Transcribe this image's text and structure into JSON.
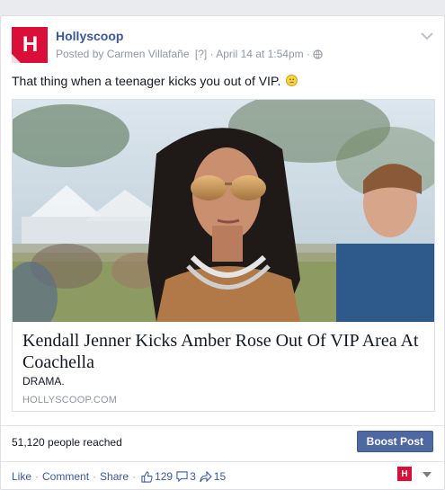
{
  "post": {
    "page_name": "Hollyscoop",
    "avatar_letter": "H",
    "posted_by": "Posted by Carmen Villafañe",
    "help_marker": "[?]",
    "date": "April 14 at 1:54pm",
    "separator": "·",
    "status_text": "That thing when a teenager kicks you out of VIP."
  },
  "link": {
    "title": "Kendall Jenner Kicks Amber Rose Out Of VIP Area At Coachella",
    "description": "DRAMA.",
    "domain": "HOLLYSCOOP.COM"
  },
  "footer": {
    "reach": "51,120 people reached",
    "boost_label": "Boost Post"
  },
  "actions": {
    "like": "Like",
    "comment": "Comment",
    "share": "Share",
    "likes_count": "129",
    "comments_count": "3",
    "shares_count": "15"
  },
  "colors": {
    "brand": "#d90f3a",
    "link_blue": "#3b5998",
    "boost_bg": "#4e69a2"
  },
  "icons": [
    "hollyscoop-logo",
    "chevron-down-icon",
    "globe-icon",
    "sad-emoji-icon",
    "thumbs-up-icon",
    "comment-bubble-icon",
    "share-arrow-icon",
    "caret-down-icon"
  ]
}
